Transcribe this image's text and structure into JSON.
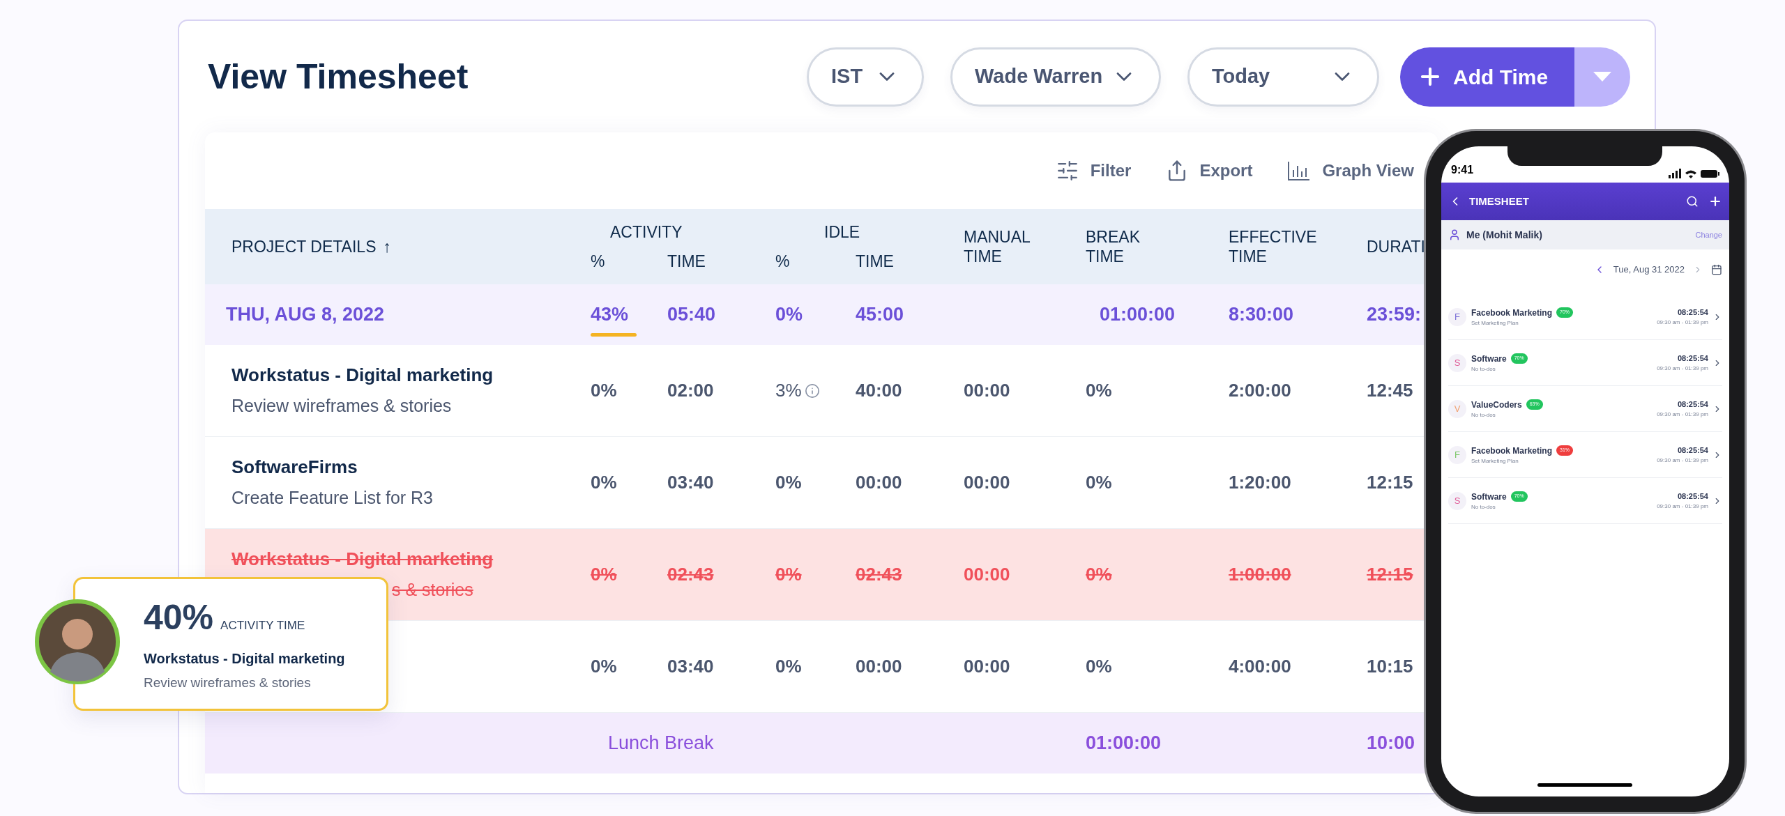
{
  "title": "View Timesheet",
  "filters": [
    {
      "label": "IST"
    },
    {
      "label": "Wade Warren"
    },
    {
      "label": "Today"
    }
  ],
  "add_button": {
    "label": "Add Time"
  },
  "toolbar": [
    {
      "kind": "filter",
      "label": "Filter"
    },
    {
      "kind": "export",
      "label": "Export"
    },
    {
      "kind": "graph",
      "label": "Graph View"
    }
  ],
  "table": {
    "header": {
      "project": "PROJECT DETAILS",
      "sort_arrow": "↑",
      "activity": "ACTIVITY",
      "idle": "IDLE",
      "activity_pct": "%",
      "activity_time": "TIME",
      "idle_pct": "%",
      "idle_time": "TIME",
      "manual": "MANUAL TIME",
      "break": "BREAK TIME",
      "effective": "EFFECTIVE TIME",
      "duration": "DURATI"
    },
    "date_row": {
      "date": "THU, AUG 8, 2022",
      "activity_pct": "43%",
      "activity_underlined": true,
      "activity_time": "05:40",
      "idle_pct": "0%",
      "idle_time": "45:00",
      "break_time": "01:00:00",
      "effective_time": "8:30:00",
      "duration": "23:59:"
    },
    "rows": [
      {
        "kind": "task",
        "project": "Workstatus - Digital marketing",
        "task": "Review wireframes & stories",
        "idle_info": true,
        "cells": [
          "0%",
          "02:00",
          "3%",
          "40:00",
          "00:00",
          "0%",
          "2:00:00",
          "12:45"
        ]
      },
      {
        "kind": "task",
        "project": "SoftwareFirms",
        "task": "Create Feature List for R3",
        "idle_info": false,
        "cells": [
          "0%",
          "03:40",
          "0%",
          "00:00",
          "00:00",
          "0%",
          "1:20:00",
          "12:15"
        ]
      },
      {
        "kind": "deleted",
        "project": "Workstatus - Digital marketing",
        "task": "s & stories",
        "idle_info": false,
        "cells": [
          "0%",
          "02:43",
          "0%",
          "02:43",
          "00:00",
          "0%",
          "1:00:00",
          "12:15"
        ]
      },
      {
        "kind": "task",
        "idle_info": false,
        "cells": [
          "0%",
          "03:40",
          "0%",
          "00:00",
          "00:00",
          "0%",
          "4:00:00",
          "10:15"
        ]
      },
      {
        "kind": "break",
        "label": "Lunch Break",
        "break_time": "01:00:00",
        "duration": "10:00"
      }
    ]
  },
  "activity_card": {
    "value": "40%",
    "caption": "ACTIVITY TIME",
    "project": "Workstatus - Digital marketing",
    "task": "Review wireframes & stories"
  },
  "phone": {
    "clock": "9:41",
    "title": "TIMESHEET",
    "user": "Me (Mohit Malik)",
    "change": "Change",
    "date": "Tue, Aug 31 2022",
    "items": [
      {
        "letter": "F",
        "color": "#7b6fd6",
        "name": "Facebook Marketing",
        "badge": "70%",
        "badge_low": false,
        "sub": "Set Marketing Plan",
        "time": "08:25:54",
        "range": "09:30 am - 01:39 pm"
      },
      {
        "letter": "S",
        "color": "#e0609a",
        "name": "Software",
        "badge": "70%",
        "badge_low": false,
        "sub": "No to-dos",
        "time": "08:25:54",
        "range": "09:30 am - 01:39 pm"
      },
      {
        "letter": "V",
        "color": "#f0a070",
        "name": "ValueCoders",
        "badge": "63%",
        "badge_low": false,
        "sub": "No to-dos",
        "time": "08:25:54",
        "range": "09:30 am - 01:39 pm"
      },
      {
        "letter": "F",
        "color": "#7cc76a",
        "name": "Facebook Marketing",
        "badge": "31%",
        "badge_low": true,
        "sub": "Set Marketing Plan",
        "time": "08:25:54",
        "range": "09:30 am - 01:39 pm"
      },
      {
        "letter": "S",
        "color": "#e0609a",
        "name": "Software",
        "badge": "70%",
        "badge_low": false,
        "sub": "No to-dos",
        "time": "08:25:54",
        "range": "09:30 am - 01:39 pm"
      }
    ]
  }
}
